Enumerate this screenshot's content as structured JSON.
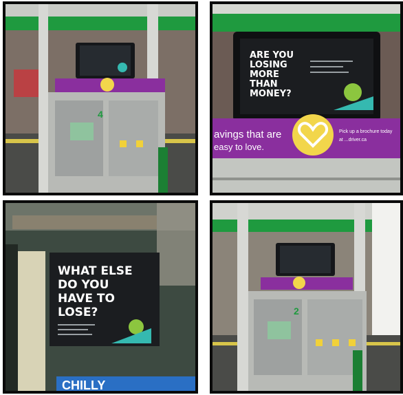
{
  "panels": {
    "top_left": {
      "pump_number": "4",
      "canopy_color": "#1f9a3f",
      "banner_color": "#8a2f9e"
    },
    "top_right": {
      "poster_headline": [
        "ARE YOU",
        "LOSING",
        "MORE",
        "THAN",
        "MONEY?"
      ],
      "banner_main": "avings that are",
      "banner_sub": "easy to love.",
      "banner_right_1": "Pick up a brochure today",
      "banner_right_2": "at ...driver.ca"
    },
    "bottom_left": {
      "poster_headline": [
        "WHAT ELSE",
        "DO YOU",
        "HAVE TO",
        "LOSE?"
      ],
      "cooler_sign": "CHILLY"
    },
    "bottom_right": {
      "pump_number": "2"
    }
  },
  "colors": {
    "purple": "#8a2f9e",
    "heart_yellow": "#f2d64b",
    "canopy_green": "#1f9a3f",
    "poster_dark": "#1b1d20",
    "poster_accent": "#35b9b0"
  }
}
